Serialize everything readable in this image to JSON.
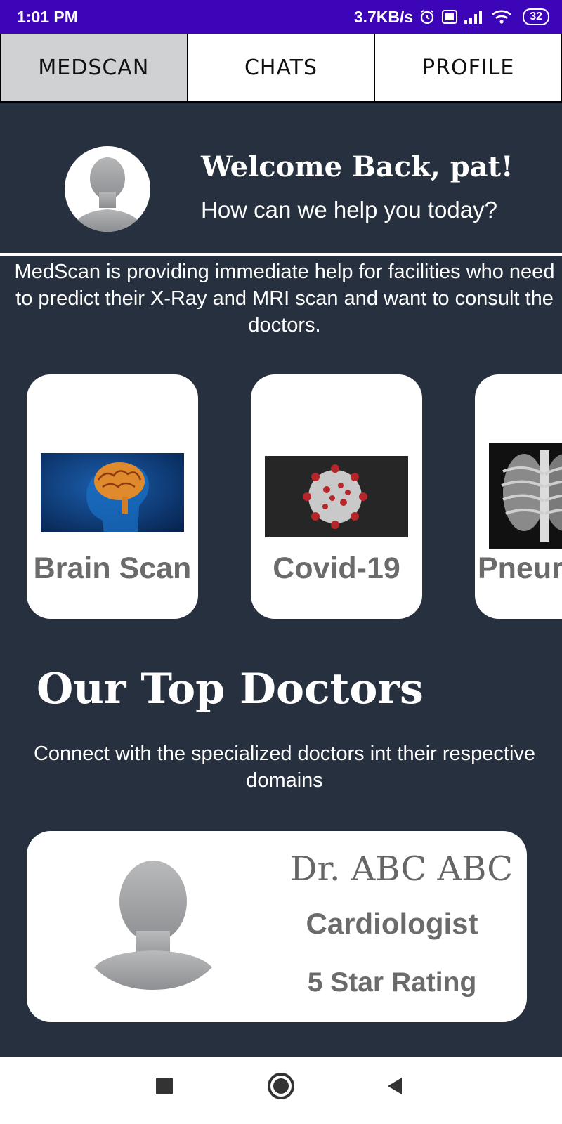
{
  "status_bar": {
    "time": "1:01 PM",
    "network_speed": "3.7KB/s",
    "battery": "32",
    "icons": [
      "alarm-icon",
      "volte-icon",
      "signal-icon",
      "wifi-icon",
      "battery-icon"
    ]
  },
  "tabs": [
    {
      "label": "MEDSCAN",
      "active": true
    },
    {
      "label": "CHATS",
      "active": false
    },
    {
      "label": "PROFILE",
      "active": false
    }
  ],
  "header": {
    "welcome": "Welcome Back, pat!",
    "subtitle": "How can we help you today?"
  },
  "intro_text": "MedScan is providing immediate help for facilities who need to predict their X-Ray and MRI scan and want to consult the doctors.",
  "scans": [
    {
      "label": "Brain Scan",
      "image": "brain-scan-image"
    },
    {
      "label": "Covid-19",
      "image": "covid-virus-image"
    },
    {
      "label": "Pneur",
      "image": "chest-xray-image"
    }
  ],
  "doctors_section": {
    "title": "Our Top Doctors",
    "subtitle": "Connect with the specialized doctors int their respective domains"
  },
  "doctor": {
    "name": "Dr. ABC ABC",
    "specialty": "Cardiologist",
    "rating": "5 Star Rating"
  },
  "nav": [
    "recents-button",
    "home-button",
    "back-button"
  ],
  "colors": {
    "status_bar": "#3c06b8",
    "background": "#27303e",
    "active_tab": "#cfd1d2",
    "card_text": "#6b6b6b"
  }
}
